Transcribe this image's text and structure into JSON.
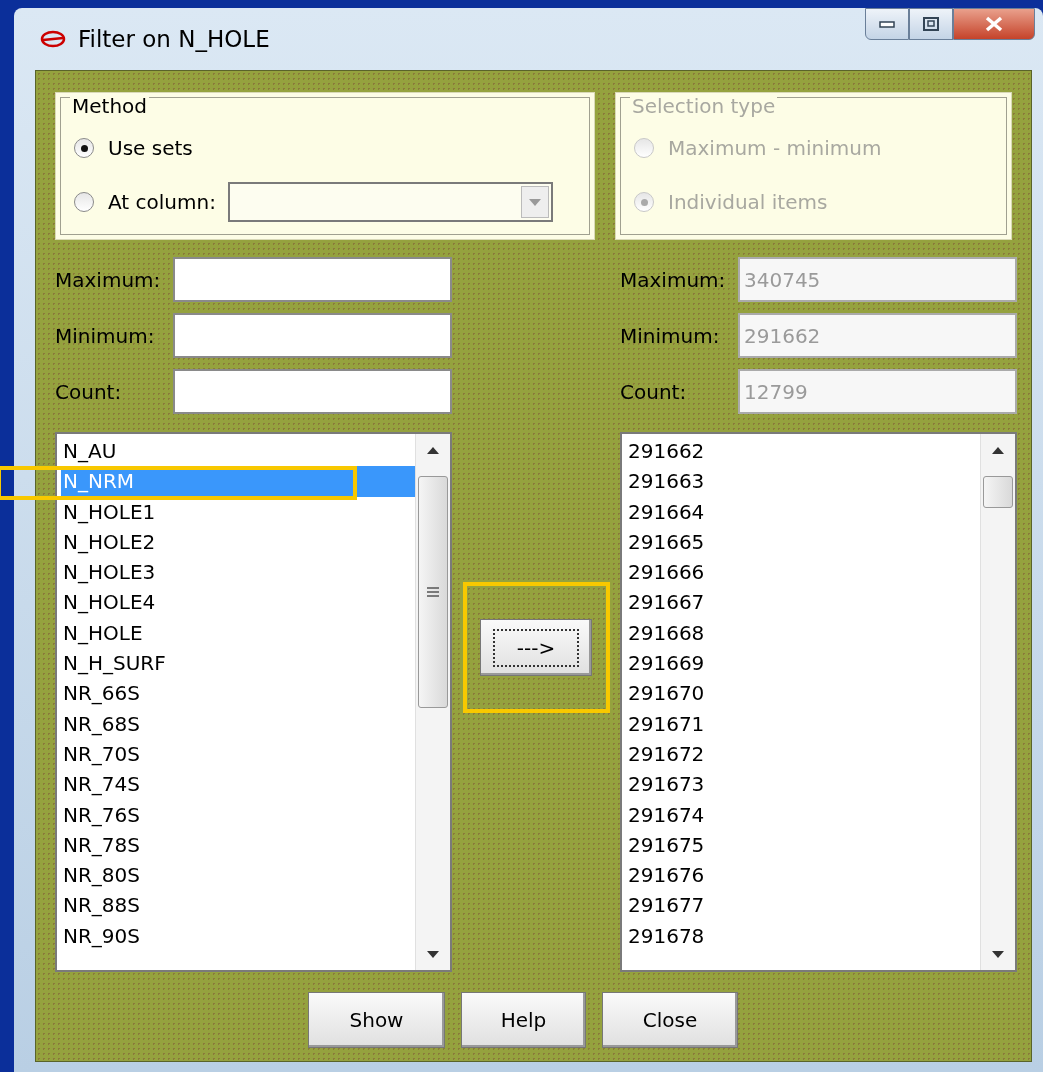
{
  "window": {
    "title": "Filter on N_HOLE"
  },
  "method": {
    "title": "Method",
    "disabled": false,
    "options": [
      {
        "label": "Use sets",
        "selected": true
      },
      {
        "label": "At column:",
        "selected": false,
        "kind": "combo"
      }
    ]
  },
  "selection_type": {
    "title": "Selection type",
    "disabled": true,
    "options": [
      {
        "label": "Maximum - minimum",
        "selected": false
      },
      {
        "label": "Individual items",
        "selected": true
      }
    ]
  },
  "left_fields": [
    {
      "label": "Maximum:",
      "disabled": false
    },
    {
      "label": "Minimum:",
      "disabled": false
    },
    {
      "label": "Count:",
      "disabled": false
    }
  ],
  "right_fields": [
    {
      "label": "Maximum:",
      "value": "340745",
      "disabled": true
    },
    {
      "label": "Minimum:",
      "value": "291662",
      "disabled": true
    },
    {
      "label": "Count:",
      "value": "12799",
      "disabled": true
    }
  ],
  "left_list": {
    "items": [
      {
        "label": "N_AU",
        "selected": false,
        "highlighted": false
      },
      {
        "label": "N_NRM",
        "selected": true,
        "highlighted": true
      },
      {
        "label": "N_HOLE1",
        "selected": false,
        "highlighted": false
      },
      {
        "label": "N_HOLE2",
        "selected": false,
        "highlighted": false
      },
      {
        "label": "N_HOLE3",
        "selected": false,
        "highlighted": false
      },
      {
        "label": "N_HOLE4",
        "selected": false,
        "highlighted": false
      },
      {
        "label": "N_HOLE",
        "selected": false,
        "highlighted": false
      },
      {
        "label": "N_H_SURF",
        "selected": false,
        "highlighted": false
      },
      {
        "label": "NR_66S",
        "selected": false,
        "highlighted": false
      },
      {
        "label": "NR_68S",
        "selected": false,
        "highlighted": false
      },
      {
        "label": "NR_70S",
        "selected": false,
        "highlighted": false
      },
      {
        "label": "NR_74S",
        "selected": false,
        "highlighted": false
      },
      {
        "label": "NR_76S",
        "selected": false,
        "highlighted": false
      },
      {
        "label": "NR_78S",
        "selected": false,
        "highlighted": false
      },
      {
        "label": "NR_80S",
        "selected": false,
        "highlighted": false
      },
      {
        "label": "NR_88S",
        "selected": false,
        "highlighted": false
      },
      {
        "label": "NR_90S",
        "selected": false,
        "highlighted": false
      }
    ]
  },
  "transfer_button": {
    "label": "--->",
    "highlighted": true
  },
  "right_list": {
    "items": [
      "291662",
      "291663",
      "291664",
      "291665",
      "291666",
      "291667",
      "291668",
      "291669",
      "291670",
      "291671",
      "291672",
      "291673",
      "291674",
      "291675",
      "291676",
      "291677",
      "291678"
    ]
  },
  "buttons": [
    {
      "label": "Show"
    },
    {
      "label": "Help"
    },
    {
      "label": "Close"
    }
  ]
}
